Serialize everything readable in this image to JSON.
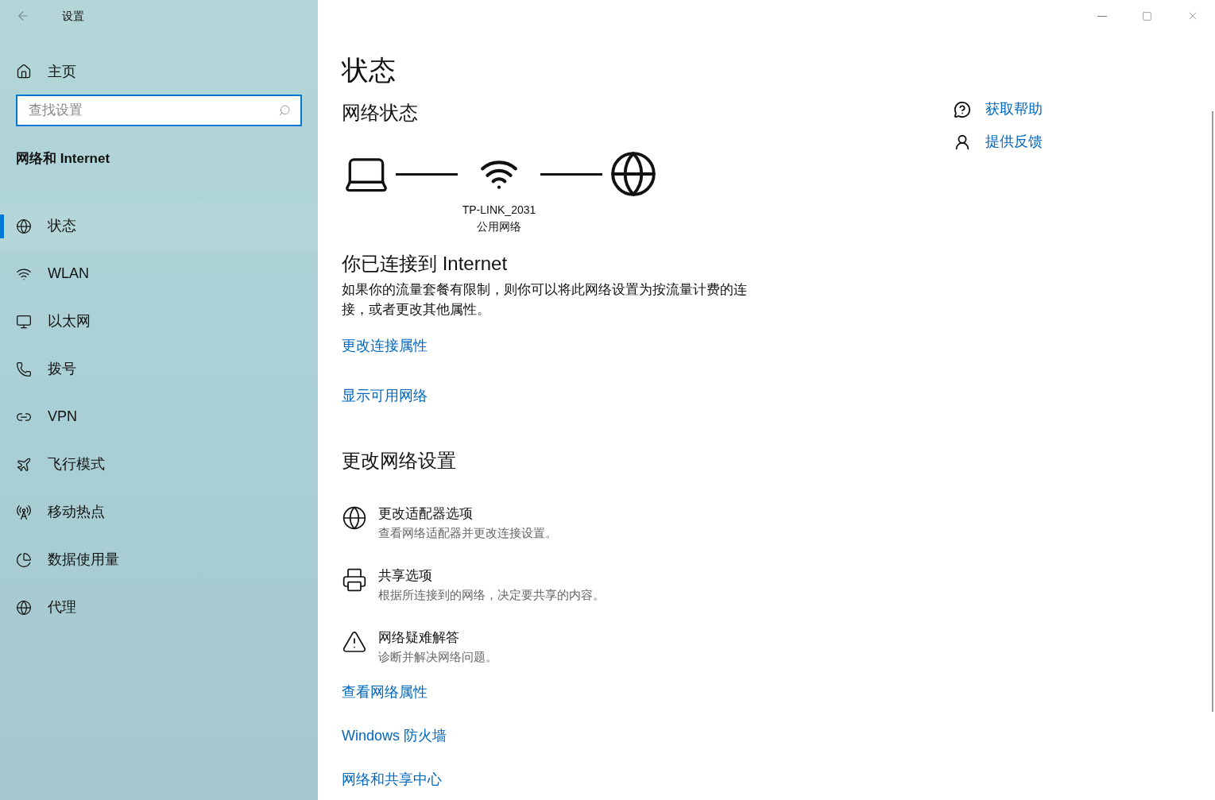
{
  "window": {
    "title": "设置"
  },
  "sidebar": {
    "home": "主页",
    "search": {
      "placeholder": "查找设置"
    },
    "section": "网络和 Internet",
    "items": [
      {
        "label": "状态",
        "selected": true
      },
      {
        "label": "WLAN",
        "selected": false
      },
      {
        "label": "以太网",
        "selected": false
      },
      {
        "label": "拨号",
        "selected": false
      },
      {
        "label": "VPN",
        "selected": false
      },
      {
        "label": "飞行模式",
        "selected": false
      },
      {
        "label": "移动热点",
        "selected": false
      },
      {
        "label": "数据使用量",
        "selected": false
      },
      {
        "label": "代理",
        "selected": false
      }
    ]
  },
  "page": {
    "title": "状态",
    "network_status": {
      "heading": "网络状态",
      "network_name": "TP-LINK_2031",
      "network_type": "公用网络",
      "connected_title": "你已连接到 Internet",
      "description": "如果你的流量套餐有限制，则你可以将此网络设置为按流量计费的连接，或者更改其他属性。",
      "links": [
        "更改连接属性",
        "显示可用网络"
      ]
    },
    "change_settings": {
      "heading": "更改网络设置",
      "options": [
        {
          "title": "更改适配器选项",
          "subtitle": "查看网络适配器并更改连接设置。"
        },
        {
          "title": "共享选项",
          "subtitle": "根据所连接到的网络，决定要共享的内容。"
        },
        {
          "title": "网络疑难解答",
          "subtitle": "诊断并解决网络问题。"
        }
      ],
      "links": [
        "查看网络属性",
        "Windows 防火墙",
        "网络和共享中心"
      ]
    }
  },
  "help": {
    "links": [
      "获取帮助",
      "提供反馈"
    ]
  }
}
